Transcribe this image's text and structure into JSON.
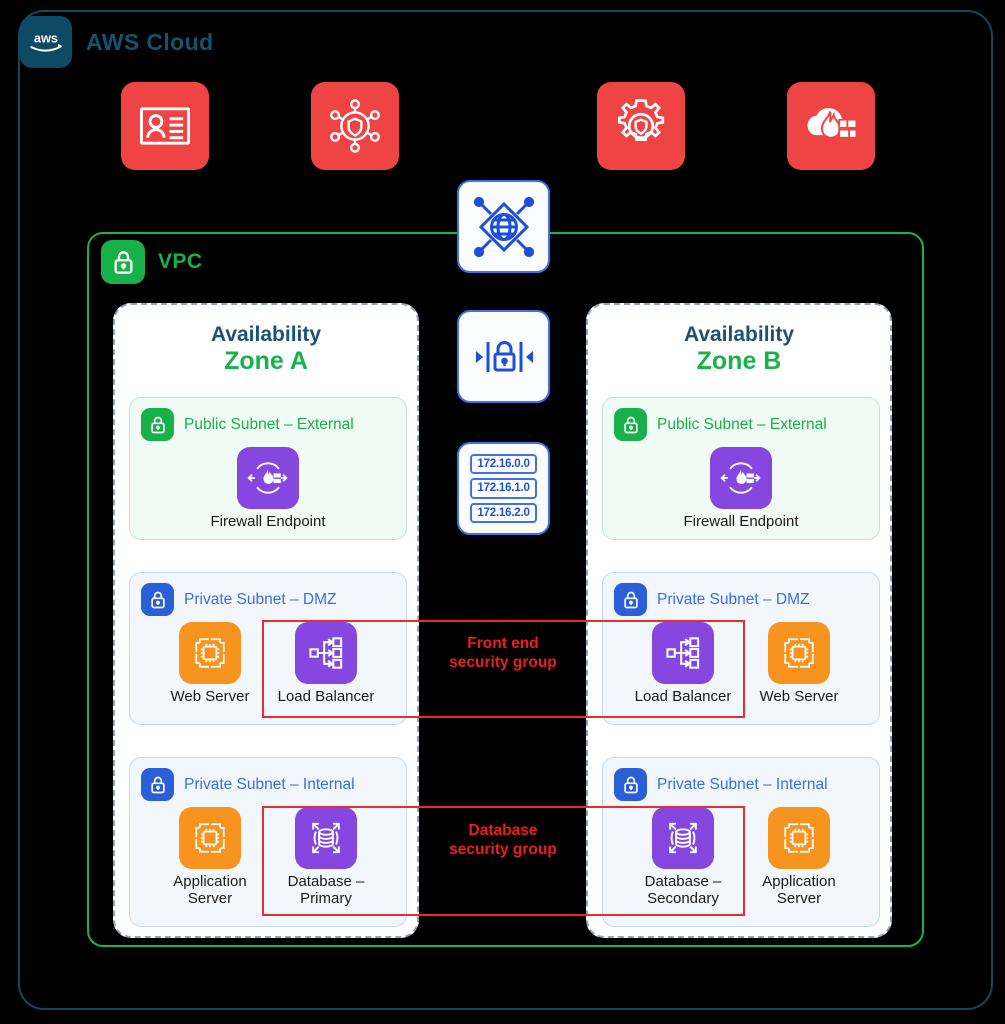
{
  "cloud": {
    "title": "AWS Cloud",
    "logo_text": "aws",
    "border_color": "#11485f"
  },
  "security_services": [
    {
      "name": "identity-card-icon",
      "label": ""
    },
    {
      "name": "network-shield-icon",
      "label": ""
    },
    {
      "name": "gear-shield-icon",
      "label": ""
    },
    {
      "name": "cloud-firewall-icon",
      "label": ""
    }
  ],
  "vpc": {
    "title": "VPC",
    "accent_color": "#18b149"
  },
  "center": {
    "internet_gateway_icon": "internet-gateway-icon",
    "network_acl_icon": "network-acl-lock-icon",
    "cidr_blocks": [
      "172.16.0.0",
      "172.16.1.0",
      "172.16.2.0"
    ]
  },
  "zones": [
    {
      "head_line1": "Availability",
      "head_line2": "Zone A",
      "subnets": [
        {
          "label": "Public Subnet – External",
          "tone": "green",
          "resources": [
            {
              "label": "Firewall Endpoint",
              "icon": "firewall-endpoint-icon",
              "color": "purple"
            }
          ]
        },
        {
          "label": "Private Subnet – DMZ",
          "tone": "blue",
          "resources": [
            {
              "label": "Web Server",
              "icon": "ec2-instance-icon",
              "color": "orange"
            },
            {
              "label": "Load Balancer",
              "icon": "load-balancer-icon",
              "color": "purple"
            }
          ]
        },
        {
          "label": "Private Subnet – Internal",
          "tone": "blue",
          "resources": [
            {
              "label": "Application\nServer",
              "icon": "ec2-instance-icon",
              "color": "orange"
            },
            {
              "label": "Database –\nPrimary",
              "icon": "database-icon",
              "color": "purple"
            }
          ]
        }
      ]
    },
    {
      "head_line1": "Availability",
      "head_line2": "Zone B",
      "subnets": [
        {
          "label": "Public Subnet – External",
          "tone": "green",
          "resources": [
            {
              "label": "Firewall Endpoint",
              "icon": "firewall-endpoint-icon",
              "color": "purple"
            }
          ]
        },
        {
          "label": "Private Subnet – DMZ",
          "tone": "blue",
          "resources": [
            {
              "label": "Load Balancer",
              "icon": "load-balancer-icon",
              "color": "purple"
            },
            {
              "label": "Web Server",
              "icon": "ec2-instance-icon",
              "color": "orange"
            }
          ]
        },
        {
          "label": "Private Subnet – Internal",
          "tone": "blue",
          "resources": [
            {
              "label": "Database –\nSecondary",
              "icon": "database-icon",
              "color": "purple"
            },
            {
              "label": "Application\nServer",
              "icon": "ec2-instance-icon",
              "color": "orange"
            }
          ]
        }
      ]
    }
  ],
  "security_groups": [
    {
      "label": "Front end\nsecurity group",
      "color": "#ee1c1c"
    },
    {
      "label": "Database\nsecurity group",
      "color": "#ee1c1c"
    }
  ]
}
